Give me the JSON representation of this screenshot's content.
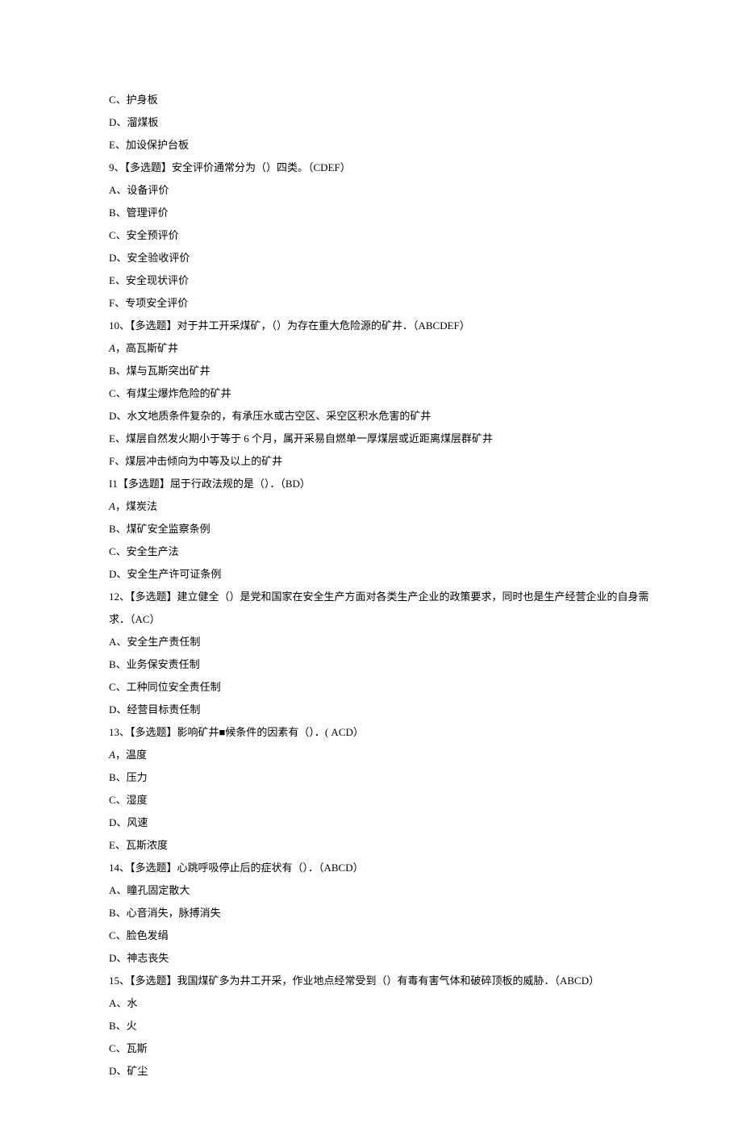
{
  "lines": [
    {
      "text": "C、护身板"
    },
    {
      "text": "D、溜煤板"
    },
    {
      "text": "E、加设保护台板"
    },
    {
      "text": "9、【多选题】安全评价通常分为（）四类。（CDEF）"
    },
    {
      "text": "A、设备评价"
    },
    {
      "text": "B、管理评价"
    },
    {
      "text": "C、安全预评价"
    },
    {
      "text": "D、安全验收评价"
    },
    {
      "text": "E、安全现状评价"
    },
    {
      "text": "F、专项安全评价"
    },
    {
      "text": "10、【多选题】对于井工开采煤矿，（）为存在重大危险源的矿井．（ABCDEF）"
    },
    {
      "italic": true,
      "prefix": "A",
      "rest": "，高瓦斯矿井"
    },
    {
      "text": "B、煤与瓦斯突出矿井"
    },
    {
      "text": "C、有煤尘爆炸危险的矿井"
    },
    {
      "text": "D、水文地质条件复杂的，有承压水或古空区、采空区积水危害的矿井"
    },
    {
      "text": "E、煤层自然发火期小于等于 6 个月，属开采易自燃单一厚煤层或近距离煤层群矿井"
    },
    {
      "text": "F、煤层冲击倾向为中等及以上的矿井"
    },
    {
      "text": "I1【多选题】屈于行政法规的是（）．（BD）"
    },
    {
      "italic": true,
      "prefix": "A",
      "rest": "，煤炭法"
    },
    {
      "text": "B、煤矿安全监察条例"
    },
    {
      "text": "C、安全生产法"
    },
    {
      "text": "D、安全生产许可证条例"
    },
    {
      "text": "12、【多选题】建立健全（）是党和国家在安全生产方面对各类生产企业的政策要求，同时也是生产经营企业的自身需"
    },
    {
      "text": "求．（AC）"
    },
    {
      "text": "A、安全生产责任制"
    },
    {
      "text": "B、业务保安责任制"
    },
    {
      "text": "C、工种同位安全责任制"
    },
    {
      "text": "D、经营目标责任制"
    },
    {
      "text": "13、【多选题】影响矿井■候条件的因素有（）．( ACD）"
    },
    {
      "italic": true,
      "prefix": "A",
      "rest": "，温度"
    },
    {
      "text": "B、压力"
    },
    {
      "text": "C、湿度"
    },
    {
      "text": "D、风速"
    },
    {
      "text": "E、瓦斯浓度"
    },
    {
      "text": "14、【多选题】心跳呼吸停止后的症状有（）．（ABCD）"
    },
    {
      "text": "A、瞳孔固定散大"
    },
    {
      "text": "B、心音消失，脉搏消失"
    },
    {
      "text": "C、脸色发绢"
    },
    {
      "text": "D、神志丧失"
    },
    {
      "text": "15、【多选题】我国煤矿多为井工开采，作业地点经常受到（）有毒有害气体和破碎顶板的威胁．（ABCD）"
    },
    {
      "text": "A、水"
    },
    {
      "text": "B、火"
    },
    {
      "text": "C、瓦斯"
    },
    {
      "text": "D、矿尘"
    }
  ]
}
